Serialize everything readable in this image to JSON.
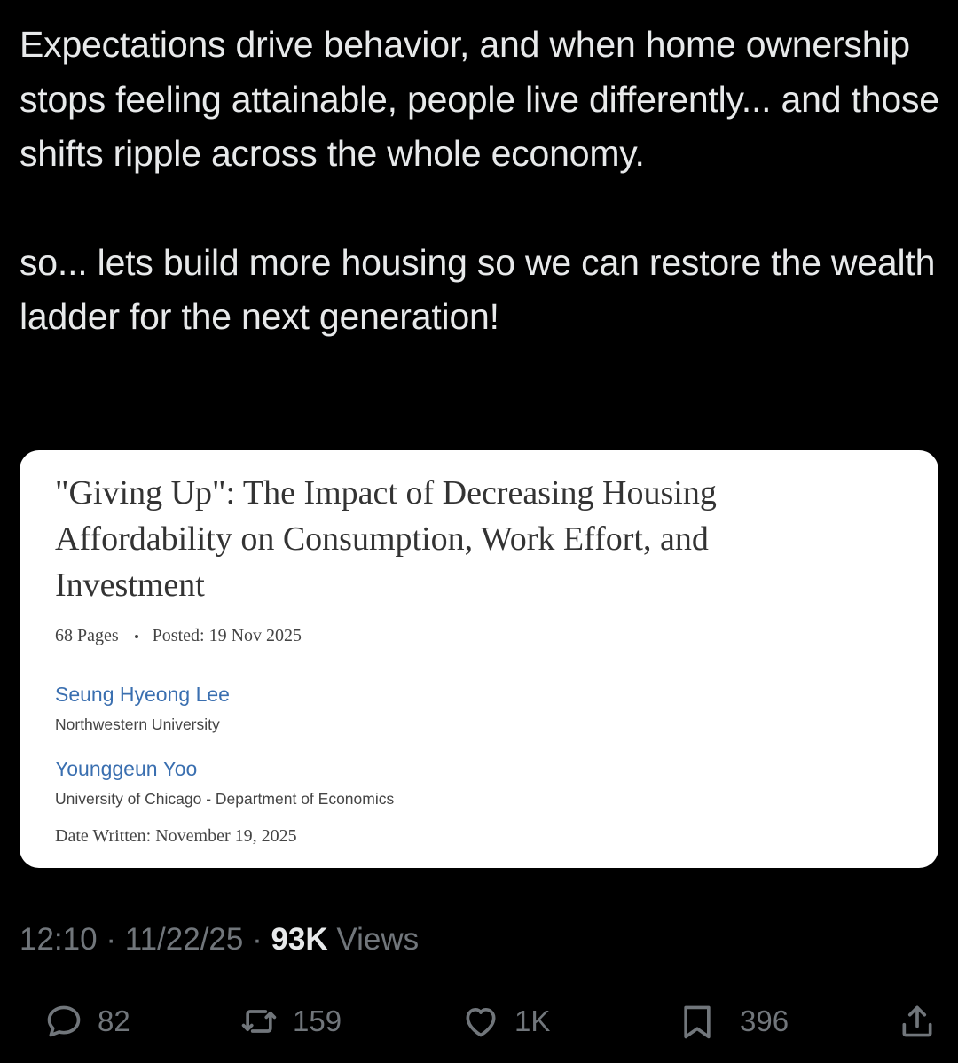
{
  "tweet": {
    "paragraph_1": "Expectations drive behavior, and when home ownership stops feeling attainable, people live differently... and those shifts ripple across the whole economy.",
    "paragraph_2": "so... lets build more housing so we can restore the wealth ladder for the next generation!"
  },
  "paper_card": {
    "title": "\"Giving Up\": The Impact of Decreasing Housing Affordability on Consumption, Work Effort, and Investment",
    "pages": "68 Pages",
    "posted": "Posted: 19 Nov 2025",
    "authors": [
      {
        "name": "Seung Hyeong Lee",
        "affiliation": "Northwestern University"
      },
      {
        "name": "Younggeun Yoo",
        "affiliation": "University of Chicago - Department of Economics"
      }
    ],
    "date_written": "Date Written: November 19, 2025"
  },
  "meta": {
    "time": "12:10",
    "date": "11/22/25",
    "views_count": "93K",
    "views_label": "Views"
  },
  "actions": {
    "replies": "82",
    "reposts": "159",
    "likes": "1K",
    "bookmarks": "396"
  },
  "icons": [
    "reply-icon",
    "repost-icon",
    "like-icon",
    "bookmark-icon",
    "share-icon"
  ]
}
